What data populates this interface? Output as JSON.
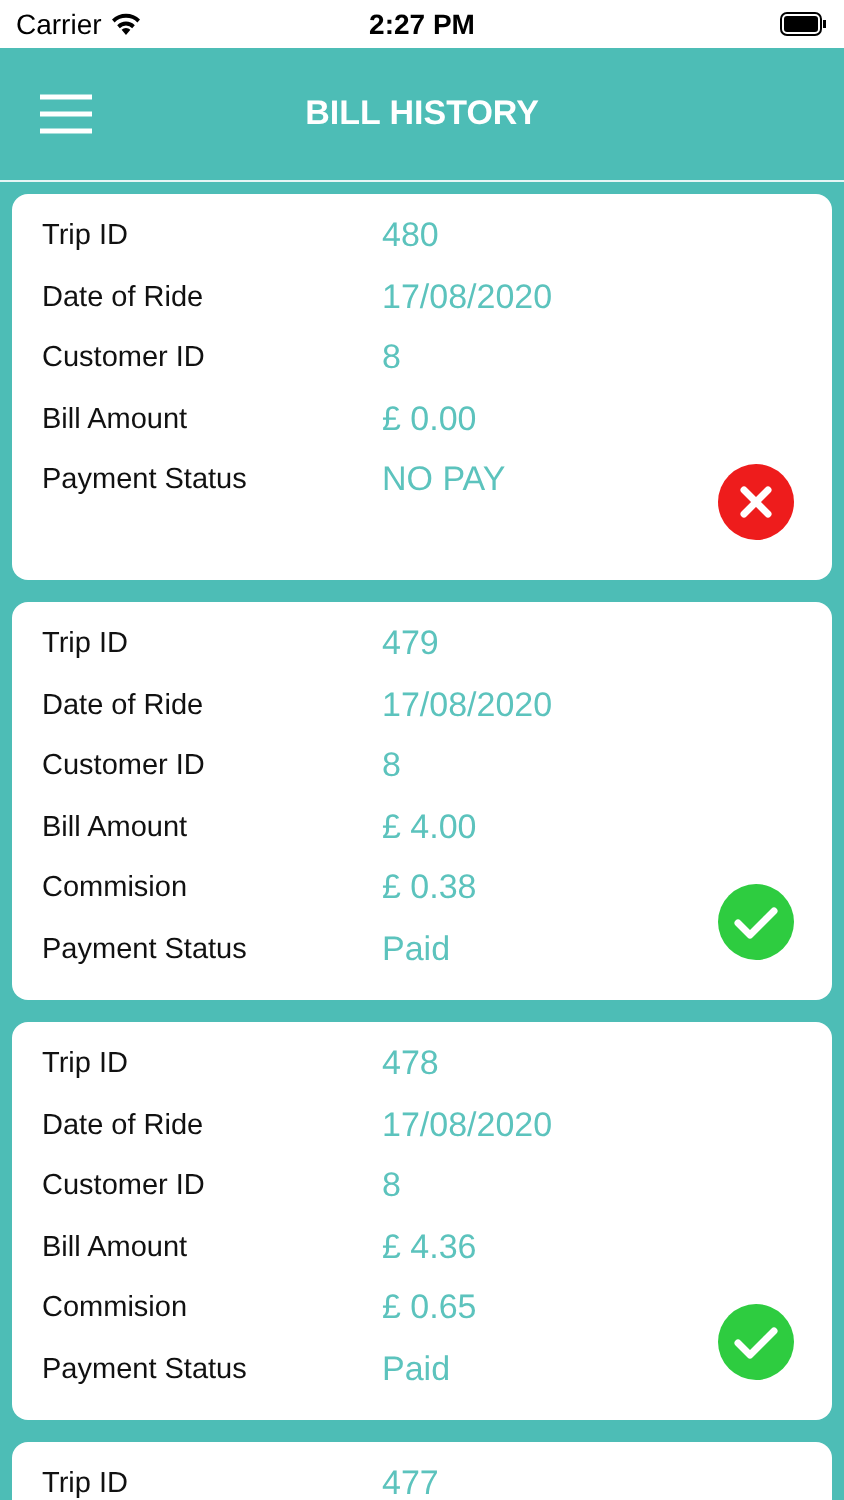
{
  "status_bar": {
    "carrier": "Carrier",
    "time": "2:27 PM"
  },
  "header": {
    "title": "BILL HISTORY"
  },
  "bills": [
    {
      "kind": "unpaid",
      "rows": [
        {
          "label": "Trip ID",
          "value": "480"
        },
        {
          "label": "Date of Ride",
          "value": "17/08/2020"
        },
        {
          "label": "Customer ID",
          "value": "8"
        },
        {
          "label": "Bill Amount",
          "value": "£ 0.00"
        },
        {
          "label": "Payment Status",
          "value": "NO PAY"
        }
      ]
    },
    {
      "kind": "paid",
      "rows": [
        {
          "label": "Trip ID",
          "value": "479"
        },
        {
          "label": "Date of Ride",
          "value": "17/08/2020"
        },
        {
          "label": "Customer ID",
          "value": "8"
        },
        {
          "label": "Bill Amount",
          "value": "£ 4.00"
        },
        {
          "label": "Commision",
          "value": "£ 0.38"
        },
        {
          "label": "Payment Status",
          "value": "Paid"
        }
      ]
    },
    {
      "kind": "paid",
      "rows": [
        {
          "label": "Trip ID",
          "value": "478"
        },
        {
          "label": "Date of Ride",
          "value": "17/08/2020"
        },
        {
          "label": "Customer ID",
          "value": "8"
        },
        {
          "label": "Bill Amount",
          "value": "£ 4.36"
        },
        {
          "label": "Commision",
          "value": "£ 0.65"
        },
        {
          "label": "Payment Status",
          "value": "Paid"
        }
      ]
    },
    {
      "rows": [
        {
          "label": "Trip ID",
          "value": "477"
        }
      ]
    }
  ]
}
